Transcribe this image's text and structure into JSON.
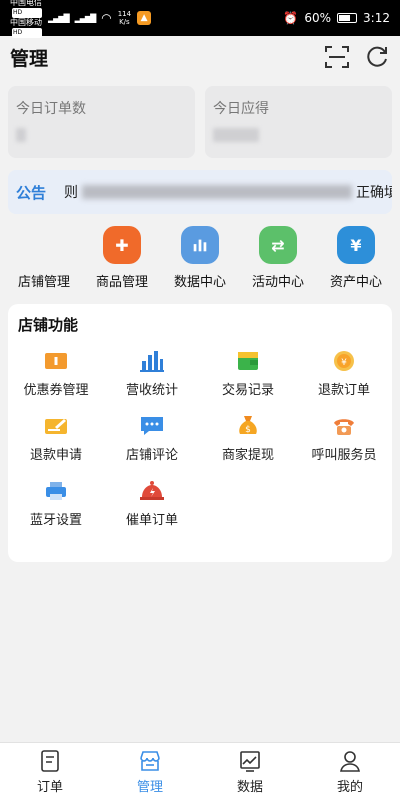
{
  "status_bar": {
    "carrier1": "中国电信",
    "carrier2": "中国移动",
    "hd": "HD",
    "speed_value": "114",
    "speed_unit": "K/s",
    "battery": "60%",
    "time": "3:12"
  },
  "header": {
    "title": "管理"
  },
  "stats": [
    {
      "label": "今日订单数"
    },
    {
      "label": "今日应得"
    }
  ],
  "notice": {
    "tag": "公告",
    "prefix": "则",
    "suffix": "正确填"
  },
  "quick_nav": [
    {
      "label": "店铺管理",
      "icon": "store-icon",
      "color": ""
    },
    {
      "label": "商品管理",
      "icon": "puzzle-icon",
      "color": "#f06a2a"
    },
    {
      "label": "数据中心",
      "icon": "bar-chart-icon",
      "color": "#5a9be0"
    },
    {
      "label": "活动中心",
      "icon": "swap-icon",
      "color": "#5cc06a"
    },
    {
      "label": "资产中心",
      "icon": "yen-icon",
      "color": "#2d8fd9"
    }
  ],
  "functions": {
    "title": "店铺功能",
    "items": [
      {
        "label": "优惠券管理",
        "icon": "coupon-icon"
      },
      {
        "label": "营收统计",
        "icon": "bar-chart-icon"
      },
      {
        "label": "交易记录",
        "icon": "wallet-icon"
      },
      {
        "label": "退款订单",
        "icon": "refund-icon"
      },
      {
        "label": "退款申请",
        "icon": "edit-card-icon"
      },
      {
        "label": "店铺评论",
        "icon": "comment-icon"
      },
      {
        "label": "商家提现",
        "icon": "money-bag-icon"
      },
      {
        "label": "呼叫服务员",
        "icon": "phone-icon"
      },
      {
        "label": "蓝牙设置",
        "icon": "printer-icon"
      },
      {
        "label": "催单订单",
        "icon": "bell-icon"
      }
    ]
  },
  "bottom_nav": [
    {
      "label": "订单",
      "icon": "order-icon"
    },
    {
      "label": "管理",
      "icon": "manage-icon",
      "active": true
    },
    {
      "label": "数据",
      "icon": "data-icon"
    },
    {
      "label": "我的",
      "icon": "profile-icon"
    }
  ]
}
